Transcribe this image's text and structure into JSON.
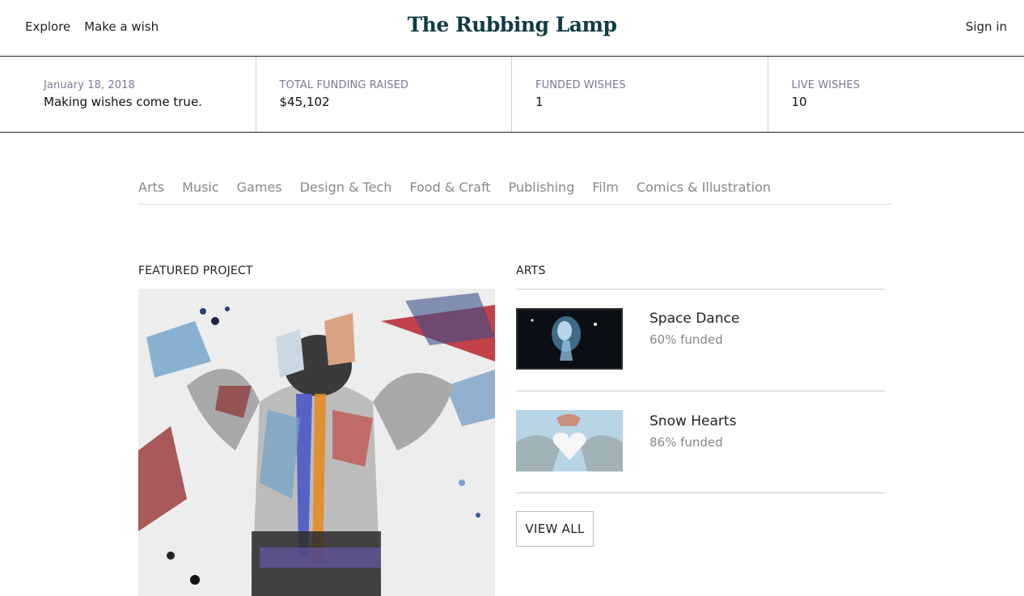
{
  "header": {
    "nav": [
      "Explore",
      "Make a wish"
    ],
    "logo": "The Rubbing Lamp",
    "signin": "Sign in"
  },
  "stats": {
    "date": "January 18, 2018",
    "tagline": "Making wishes come true.",
    "funding_label": "TOTAL FUNDING RAISED",
    "funding_value": "$45,102",
    "funded_label": "FUNDED WISHES",
    "funded_value": "1",
    "live_label": "LIVE WISHES",
    "live_value": "10"
  },
  "categories": [
    "Arts",
    "Music",
    "Games",
    "Design & Tech",
    "Food & Craft",
    "Publishing",
    "Film",
    "Comics & Illustration"
  ],
  "featured": {
    "title": "FEATURED PROJECT"
  },
  "arts": {
    "title": "ARTS",
    "projects": [
      {
        "title": "Space Dance",
        "funded": "60% funded",
        "funded_pct": 60
      },
      {
        "title": "Snow Hearts",
        "funded": "86% funded",
        "funded_pct": 86
      }
    ],
    "view_all": "VIEW ALL"
  },
  "colors": {
    "logo": "#0f3b44",
    "stat_label": "#7a7b95",
    "muted": "#888888"
  }
}
